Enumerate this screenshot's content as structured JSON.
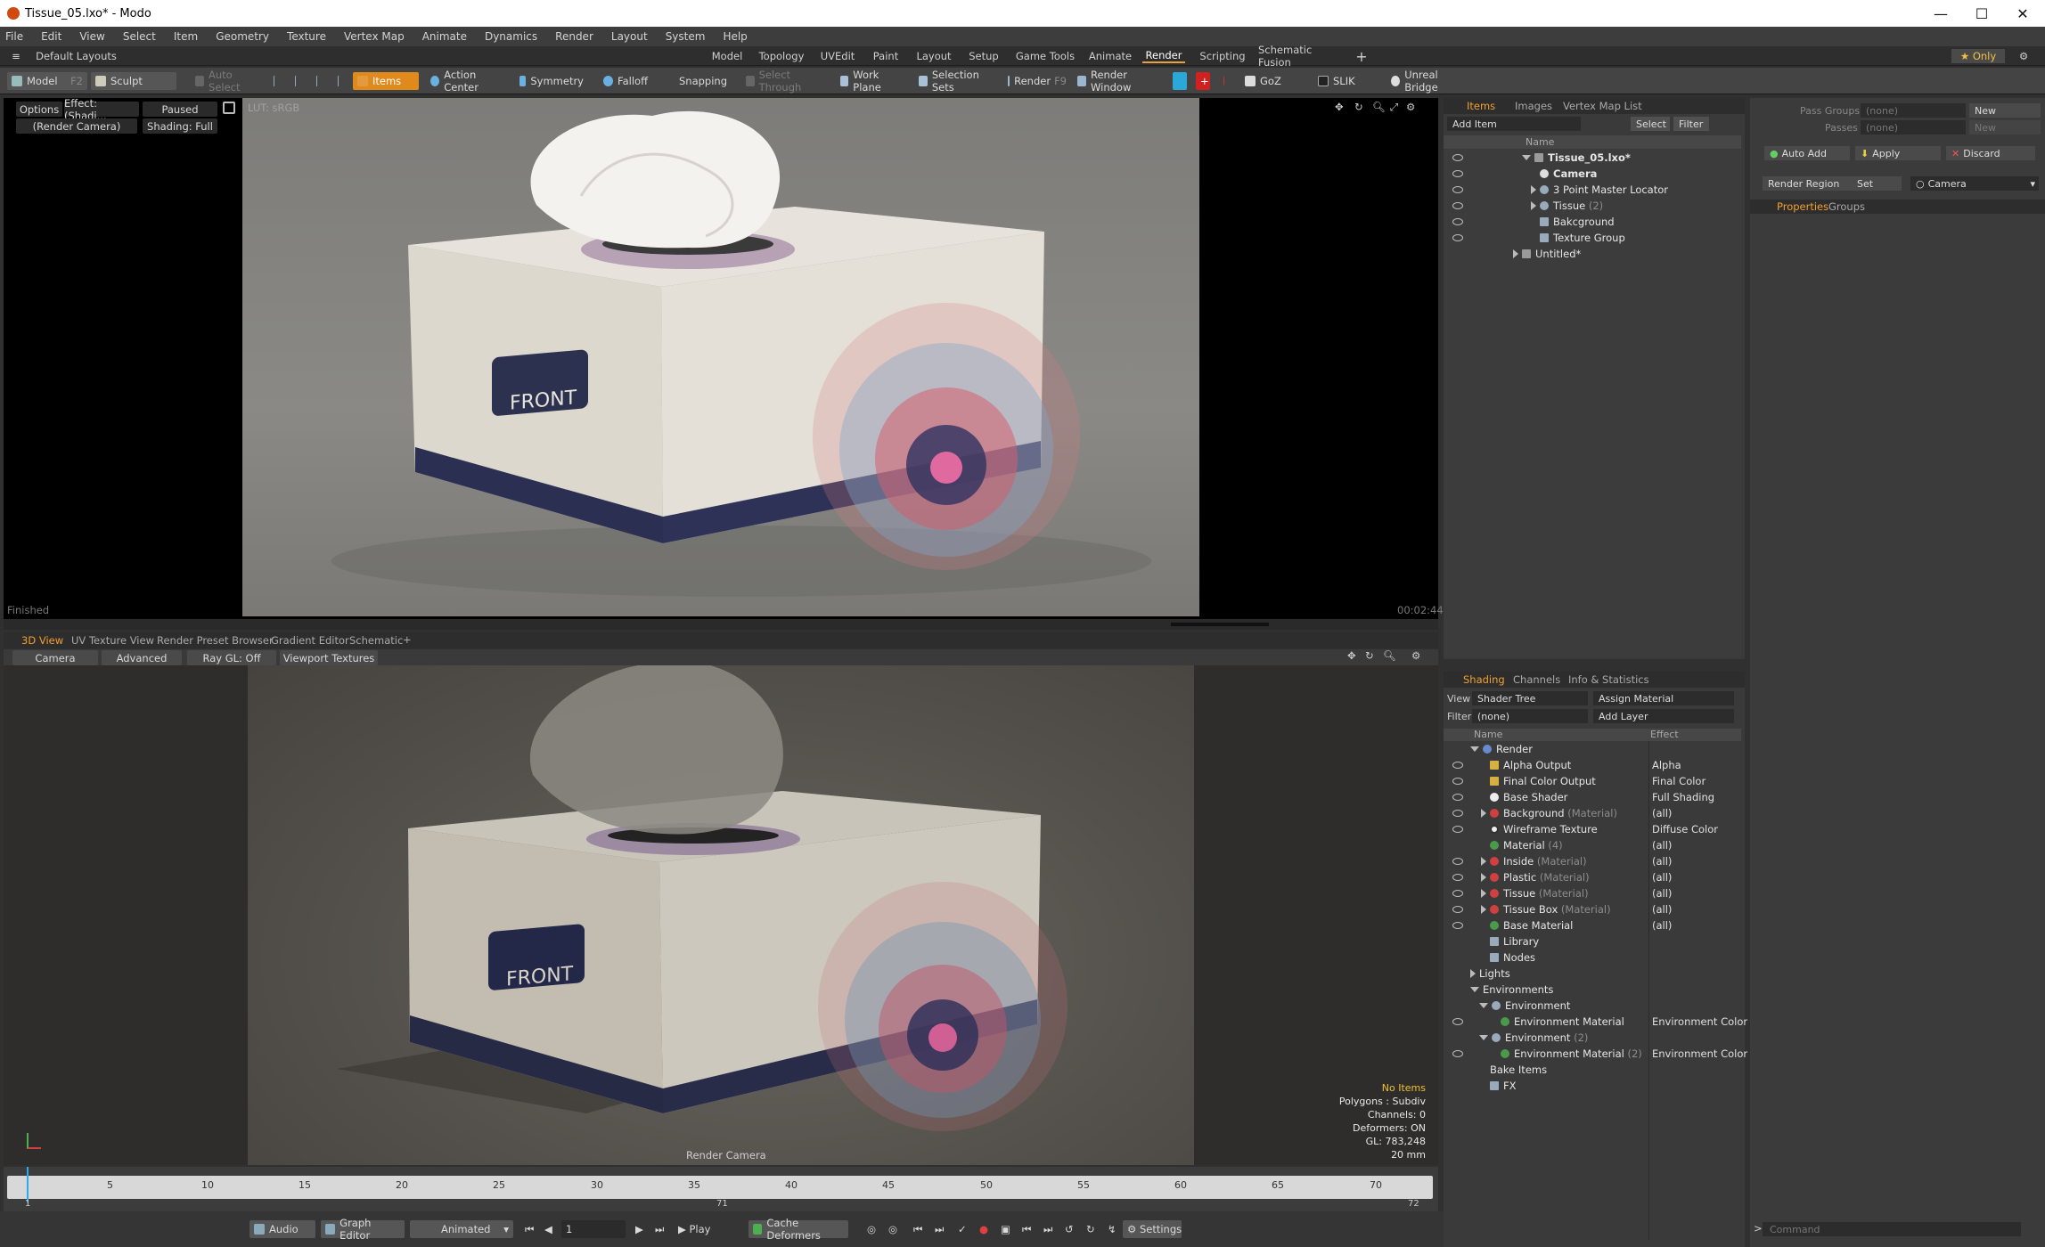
{
  "window": {
    "title": "Tissue_05.lxo* - Modo",
    "controls": [
      "—",
      "☐",
      "✕"
    ]
  },
  "menu": [
    "File",
    "Edit",
    "View",
    "Select",
    "Item",
    "Geometry",
    "Texture",
    "Vertex Map",
    "Animate",
    "Dynamics",
    "Render",
    "Layout",
    "System",
    "Help"
  ],
  "layout": {
    "dropdown": "Default Layouts",
    "tabs": [
      "Model",
      "Topology",
      "UVEdit",
      "Paint",
      "Layout",
      "Setup",
      "Game Tools",
      "Animate",
      "Render",
      "Scripting",
      "Schematic Fusion"
    ],
    "active": "Render",
    "only": "Only",
    "add": "+"
  },
  "toolbar": {
    "model": "Model",
    "model_key": "F2",
    "sculpt": "Sculpt",
    "auto_select": "Auto Select",
    "items": "Items",
    "action_center": "Action Center",
    "symmetry": "Symmetry",
    "falloff": "Falloff",
    "snapping": "Snapping",
    "select_through": "Select Through",
    "work_plane": "Work Plane",
    "selection_sets": "Selection Sets",
    "render": "Render",
    "render_key": "F9",
    "render_window": "Render Window",
    "goz": "GoZ",
    "slik": "SLIK",
    "unreal_bridge": "Unreal Bridge"
  },
  "viewport1": {
    "options": "Options",
    "effect": "Effect: (Shadi...",
    "paused": "Paused",
    "camera": "(Render Camera)",
    "shading": "Shading: Full",
    "lut": "LUT: sRGB",
    "status": "Finished",
    "time": "00:02:44",
    "front_label": "FRONT"
  },
  "viewport2": {
    "tabs": [
      "3D View",
      "UV Texture View",
      "Render Preset Browser",
      "Gradient Editor",
      "Schematic"
    ],
    "add": "+",
    "bar": [
      "Camera",
      "Advanced",
      "Ray GL: Off",
      "Viewport Textures"
    ],
    "front_label": "FRONT",
    "caption": "Render Camera",
    "stats": [
      "No Items",
      "Polygons : Subdiv",
      "Channels: 0",
      "Deformers: ON",
      "GL: 783,248",
      "20 mm"
    ]
  },
  "timeline": {
    "ticks": [
      "5",
      "10",
      "15",
      "20",
      "25",
      "30",
      "35",
      "40",
      "45",
      "50",
      "55",
      "60",
      "65",
      "70"
    ],
    "start": "1",
    "mid": "71",
    "end": "72"
  },
  "bottom": {
    "audio": "Audio",
    "graph_editor": "Graph Editor",
    "animated": "Animated",
    "frame": "1",
    "play": "Play",
    "cache": "Cache Deformers",
    "settings": "Settings"
  },
  "items_panel": {
    "tabs": [
      "Items",
      "Images",
      "Vertex Map List"
    ],
    "add_item": "Add Item",
    "select": "Select",
    "filter": "Filter",
    "col_name": "Name",
    "rows": [
      {
        "label": "Tissue_05.lxo*",
        "suffix": ""
      },
      {
        "label": "Camera",
        "suffix": ""
      },
      {
        "label": "3 Point Master Locator",
        "suffix": ""
      },
      {
        "label": "Tissue",
        "suffix": "(2)"
      },
      {
        "label": "Bakcground",
        "suffix": ""
      },
      {
        "label": "Texture Group",
        "suffix": ""
      },
      {
        "label": "Untitled*",
        "suffix": ""
      }
    ]
  },
  "pass_panel": {
    "pass_groups": "Pass Groups",
    "passes": "Passes",
    "none": "(none)",
    "new": "New",
    "auto_add": "Auto Add",
    "apply": "Apply",
    "discard": "Discard",
    "render_region": "Render Region",
    "set": "Set",
    "camera": "Camera",
    "tabs": [
      "Properties",
      "Groups"
    ]
  },
  "shading_panel": {
    "tabs": [
      "Shading",
      "Channels",
      "Info & Statistics"
    ],
    "view_label": "View",
    "view_value": "Shader Tree",
    "assign": "Assign Material",
    "filter_label": "Filter",
    "filter_value": "(none)",
    "add_layer": "Add Layer",
    "col_name": "Name",
    "col_effect": "Effect",
    "rows": [
      {
        "label": "Render",
        "suffix": "",
        "effect": ""
      },
      {
        "label": "Alpha Output",
        "suffix": "",
        "effect": "Alpha"
      },
      {
        "label": "Final Color Output",
        "suffix": "",
        "effect": "Final Color"
      },
      {
        "label": "Base Shader",
        "suffix": "",
        "effect": "Full Shading"
      },
      {
        "label": "Background",
        "suffix": "(Material)",
        "effect": "(all)"
      },
      {
        "label": "Wireframe Texture",
        "suffix": "",
        "effect": "Diffuse Color"
      },
      {
        "label": "Material",
        "suffix": "(4)",
        "effect": "(all)"
      },
      {
        "label": "Inside",
        "suffix": "(Material)",
        "effect": "(all)"
      },
      {
        "label": "Plastic",
        "suffix": "(Material)",
        "effect": "(all)"
      },
      {
        "label": "Tissue",
        "suffix": "(Material)",
        "effect": "(all)"
      },
      {
        "label": "Tissue Box",
        "suffix": "(Material)",
        "effect": "(all)"
      },
      {
        "label": "Base Material",
        "suffix": "",
        "effect": "(all)"
      },
      {
        "label": "Library",
        "suffix": "",
        "effect": ""
      },
      {
        "label": "Nodes",
        "suffix": "",
        "effect": ""
      },
      {
        "label": "Lights",
        "suffix": "",
        "effect": ""
      },
      {
        "label": "Environments",
        "suffix": "",
        "effect": ""
      },
      {
        "label": "Environment",
        "suffix": "",
        "effect": ""
      },
      {
        "label": "Environment Material",
        "suffix": "",
        "effect": "Environment Color"
      },
      {
        "label": "Environment",
        "suffix": "(2)",
        "effect": ""
      },
      {
        "label": "Environment Material",
        "suffix": "(2)",
        "effect": "Environment Color"
      },
      {
        "label": "Bake Items",
        "suffix": "",
        "effect": ""
      },
      {
        "label": "FX",
        "suffix": "",
        "effect": ""
      }
    ]
  },
  "command": {
    "placeholder": "Command",
    "prompt": ">"
  }
}
